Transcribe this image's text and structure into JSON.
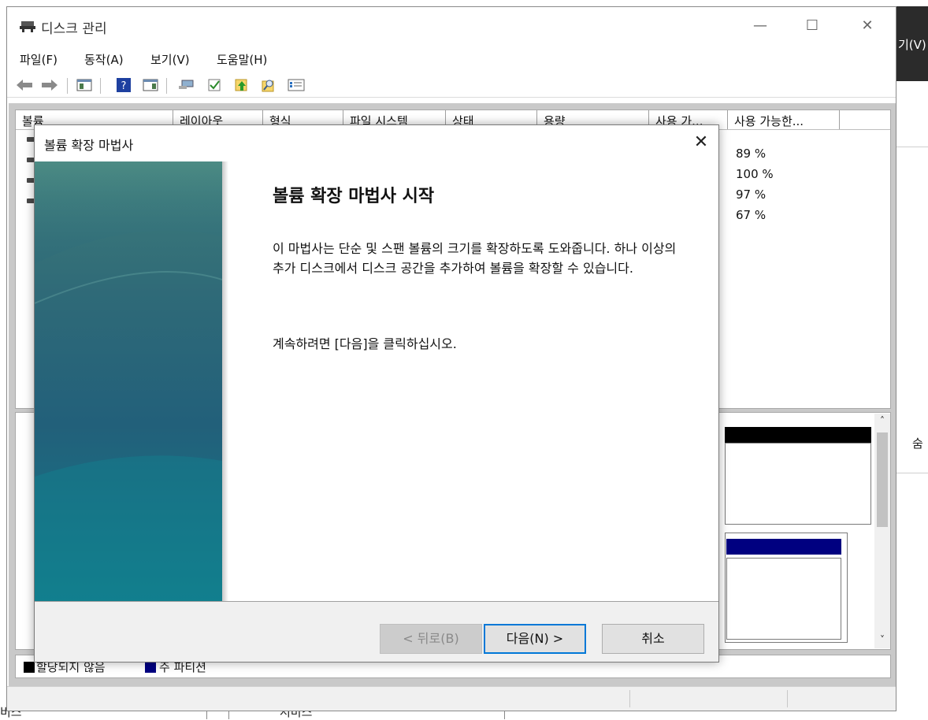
{
  "app": {
    "title": "디스크 관리",
    "window_controls": {
      "minimize": "—",
      "maximize": "☐",
      "close": "✕"
    }
  },
  "menu": [
    "파일(F)",
    "동작(A)",
    "보기(V)",
    "도움말(H)"
  ],
  "toolbar": {
    "icons": [
      "back-arrow-icon",
      "forward-arrow-icon",
      "console-tree-icon",
      "help-icon",
      "action-pane-icon",
      "connect-icon",
      "check-icon",
      "up-icon",
      "search-icon",
      "properties-icon"
    ]
  },
  "volume_table": {
    "columns": [
      "볼륨",
      "레이아웃",
      "형식",
      "파일 시스템",
      "상태",
      "용량",
      "사용 가...",
      "사용 가능한..."
    ],
    "rows": [
      {
        "free_pct": "89 %"
      },
      {
        "free_pct": "100 %"
      },
      {
        "free_pct": "97 %"
      },
      {
        "free_pct": "67 %"
      }
    ]
  },
  "legend": {
    "unallocated": "할당되지 않음",
    "primary_partition": "주 파티션",
    "colors": {
      "unallocated": "#000000",
      "primary_partition": "#000080"
    }
  },
  "background": {
    "top_right_text": "기(V)",
    "right_text": "숨",
    "bottom_text": "서비스",
    "bottom_left_text": "비스"
  },
  "wizard": {
    "title": "볼륨 확장 마법사",
    "heading": "볼륨 확장 마법사 시작",
    "description": "이 마법사는 단순 및 스팬 볼륨의 크기를 확장하도록 도와줍니다. 하나 이상의 추가 디스크에서 디스크 공간을 추가하여 볼륨을 확장할 수 있습니다.",
    "continue_text": "계속하려면 [다음]을 클릭하십시오.",
    "buttons": {
      "back": "< 뒤로(B)",
      "next": "다음(N) >",
      "cancel": "취소"
    },
    "close": "✕"
  }
}
